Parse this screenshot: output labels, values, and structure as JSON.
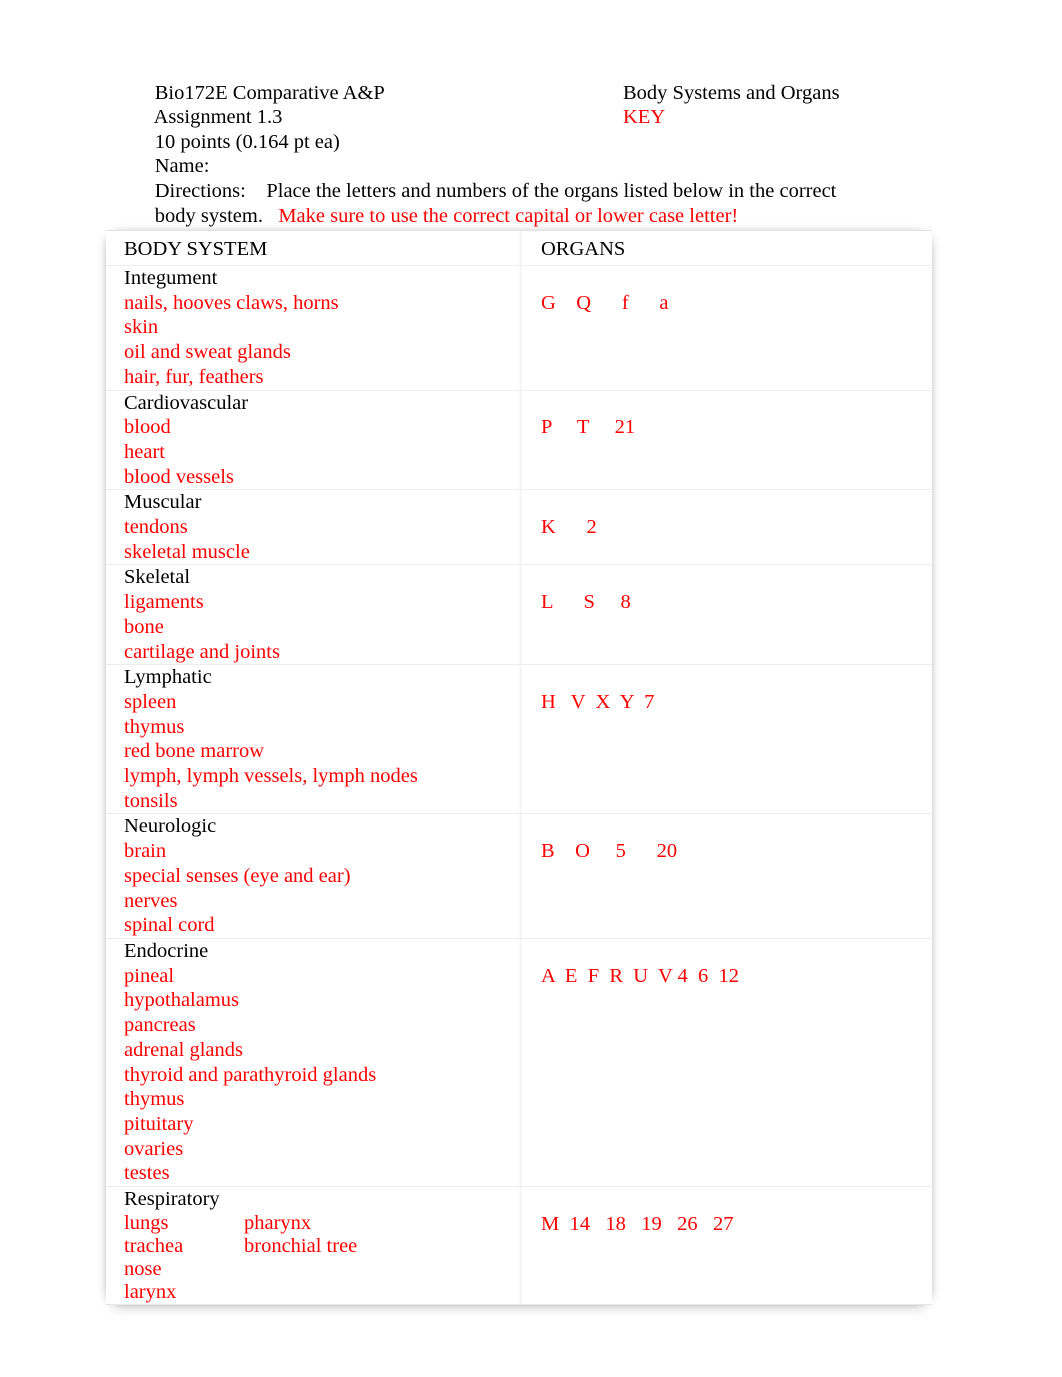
{
  "document": {
    "course": "Bio172E Comparative A&P",
    "assignment": "Assignment 1.3",
    "assignment_right": "Body Systems and Organs",
    "points": "10 points (0.164 pt ea)",
    "key_label": "KEY",
    "name_label": "Name:",
    "directions_label": "Directions:",
    "directions_text": "Place the letters and numbers of the organs listed below in the correct",
    "directions_cont": "body system.",
    "directions_note": "Make sure to use the correct capital or lower case letter!"
  },
  "colors": {
    "answer_red": "#ff0000",
    "text_black": "#000000",
    "border_gray": "#ededed"
  },
  "table": {
    "header": {
      "system": "BODY SYSTEM",
      "organs": "ORGANS"
    },
    "rows": [
      {
        "system": "Integument",
        "organs": [
          "nails, hooves claws, horns",
          "skin",
          "oil and sweat glands",
          "hair, fur, feathers"
        ],
        "codes": "G    Q      f      a"
      },
      {
        "system": "Cardiovascular",
        "organs": [
          "blood",
          "heart",
          "blood vessels"
        ],
        "codes": "P     T     21"
      },
      {
        "system": "Muscular",
        "organs": [
          "tendons",
          "skeletal muscle"
        ],
        "codes": "K      2"
      },
      {
        "system": "Skeletal",
        "organs": [
          "ligaments",
          "bone",
          "cartilage and joints"
        ],
        "codes": "L      S     8"
      },
      {
        "system": "Lymphatic",
        "organs": [
          "spleen",
          "thymus",
          "red bone marrow",
          "lymph, lymph vessels, lymph nodes",
          "tonsils"
        ],
        "codes": "H   V  X  Y  7"
      },
      {
        "system": "Neurologic",
        "organs": [
          "brain",
          "special senses (eye and ear)",
          "nerves",
          "spinal cord"
        ],
        "codes": "B    O     5      20"
      },
      {
        "system": "Endocrine",
        "organs": [
          "pineal",
          "hypothalamus",
          "pancreas",
          "adrenal glands",
          "thyroid and parathyroid glands",
          "thymus",
          "pituitary",
          "ovaries",
          "testes"
        ],
        "codes": "A  E  F  R  U  V 4  6  12"
      },
      {
        "system": "Respiratory",
        "organs_two_col": [
          {
            "first": "lungs",
            "second": "pharynx"
          },
          {
            "first": "trachea",
            "second": "bronchial tree"
          },
          {
            "first": "nose",
            "second": ""
          },
          {
            "first": "larynx",
            "second": ""
          }
        ],
        "codes": "M  14   18   19   26   27"
      }
    ]
  }
}
